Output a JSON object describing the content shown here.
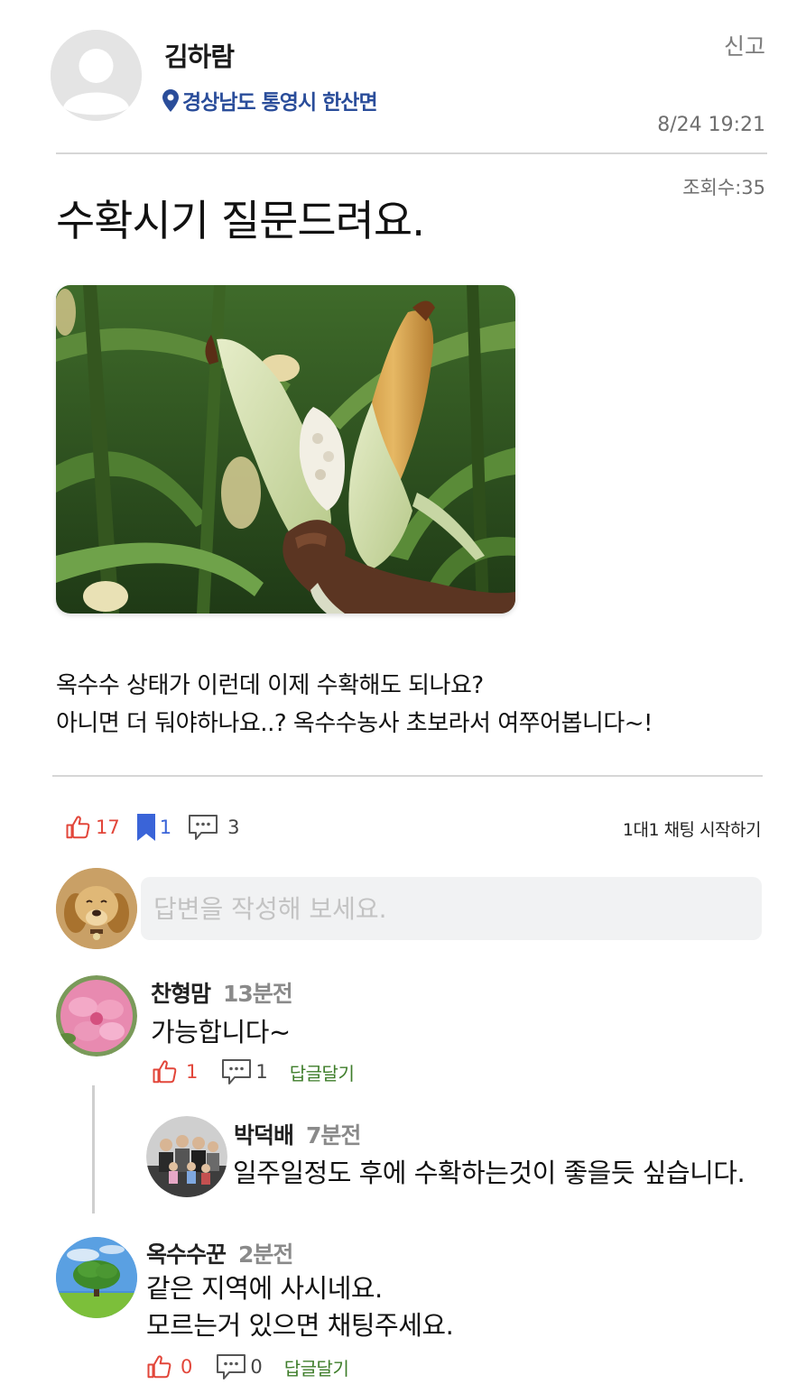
{
  "post": {
    "author": "김하람",
    "location": "경상남도 통영시 한산면",
    "report_label": "신고",
    "timestamp": "8/24 19:21",
    "views_label": "조회수:35",
    "title": "수확시기 질문드려요.",
    "body_line1": "옥수수 상태가 이런데 이제 수확해도 되나요?",
    "body_line2": "아니면 더 둬야하나요..? 옥수수농사 초보라서 여쭈어봅니다~!"
  },
  "actions": {
    "like_count": "17",
    "bookmark_count": "1",
    "comment_count": "3",
    "chat_start_label": "1대1 채팅 시작하기"
  },
  "reply_input": {
    "placeholder": "답변을 작성해 보세요."
  },
  "comments": [
    {
      "name": "찬형맘",
      "time": "13분전",
      "text": "가능합니다~",
      "like_count": "1",
      "comment_count": "1",
      "reply_label": "답글달기",
      "replies": [
        {
          "name": "박덕배",
          "time": "7분전",
          "text": "일주일정도 후에 수확하는것이 좋을듯 싶습니다."
        }
      ]
    },
    {
      "name": "옥수수꾼",
      "time": "2분전",
      "text_line1": "같은 지역에 사시네요.",
      "text_line2": "모르는거 있으면 채팅주세요.",
      "like_count": "0",
      "comment_count": "0",
      "reply_label": "답글달기"
    }
  ],
  "icons": {
    "like": "thumbs-up-icon",
    "bookmark": "bookmark-icon",
    "comment": "speech-bubble-icon",
    "location": "map-pin-icon"
  },
  "colors": {
    "like": "#e2463a",
    "bookmark": "#3a64d8",
    "location": "#2a4d9a",
    "reply_link": "#3e7d2a"
  }
}
